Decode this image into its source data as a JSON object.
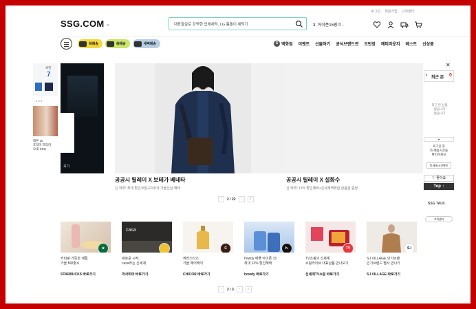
{
  "util_links": [
    "로그인",
    "회원가입",
    "고객센터"
  ],
  "logo": "SSG.COM",
  "search": {
    "query": "대표들살로 강력한 입체세탁, LG 통돌이 세탁기"
  },
  "ranking": "3. 아이폰15핑크 -",
  "delivery_pills": [
    "쓱배송",
    "쓱배송",
    "새벽배송"
  ],
  "nav": {
    "items": [
      "백화점",
      "이벤트",
      "선물하기",
      "공식브랜드관",
      "오반장",
      "해피라운지",
      "베스트",
      "신상품"
    ]
  },
  "left_partial": {
    "card_label": "사전",
    "card_number": "7",
    "text": "레몬 10\n프리미 프리미\n오세 SSG"
  },
  "dark_banner": {
    "caption": "육가"
  },
  "hero": {
    "left": {
      "title": "공공시 릴레이 X 보테가 베네타",
      "subtitle": "신 하루! 최대 할인쿠폰+21주차 가을신상 혜택"
    },
    "right": {
      "title": "공공시 릴레이 X 설화수",
      "subtitle": "신 하루! 12% 할인혜택+신세계백화점 상품권 증정"
    },
    "pager": "2 / 22"
  },
  "sidebar": {
    "recent_label": "최근 본",
    "recent_count": "0",
    "empty_text": "최근 본 상품\n없습니다\n없습니다",
    "login_text": "로그인 후\n쓱-배송시간을\n확인하세요",
    "login_button": "쓱-배송시간확인",
    "like_label": "좋아요",
    "top_label": "Top",
    "talk_label": "SSG TALK",
    "cs_label": "고객센터"
  },
  "brands": [
    {
      "text": "커피랑 가득한 계절\n가을 MD출시",
      "link": "STARBUCKS 바로가기",
      "badge": "★"
    },
    {
      "text": "새로운 시작,\ncasa라는 신세계",
      "link": "까사미아 바로가기",
      "badge": "●"
    },
    {
      "text": "케라스타즈\n가을 헤어케어",
      "link": "CHICOR 바로가기",
      "badge": "C"
    },
    {
      "text": "howdy 애플 아이폰 15\n최대 12% 할인혜택",
      "link": "howdy 바로가기",
      "badge": "h."
    },
    {
      "text": "TV쇼핑의 신세계\n쇼핑라이브 대표상품 만나보기",
      "link": "신세계TV쇼핑 바로가기",
      "badge": "TV"
    },
    {
      "text": "S.I.VILLAGE 인기브랜\n인기브랜드 별사 만나기",
      "link": "S.I.VILLAGE 바로가기",
      "badge": "S.I"
    }
  ],
  "brand_pager": "2 / 3",
  "colors": {
    "frame": "#c40000",
    "search_border": "#7fd0c0",
    "pill_yellow": "#f5d93b",
    "pill_green": "#cde56a",
    "pill_blue": "#b9cfe6"
  }
}
